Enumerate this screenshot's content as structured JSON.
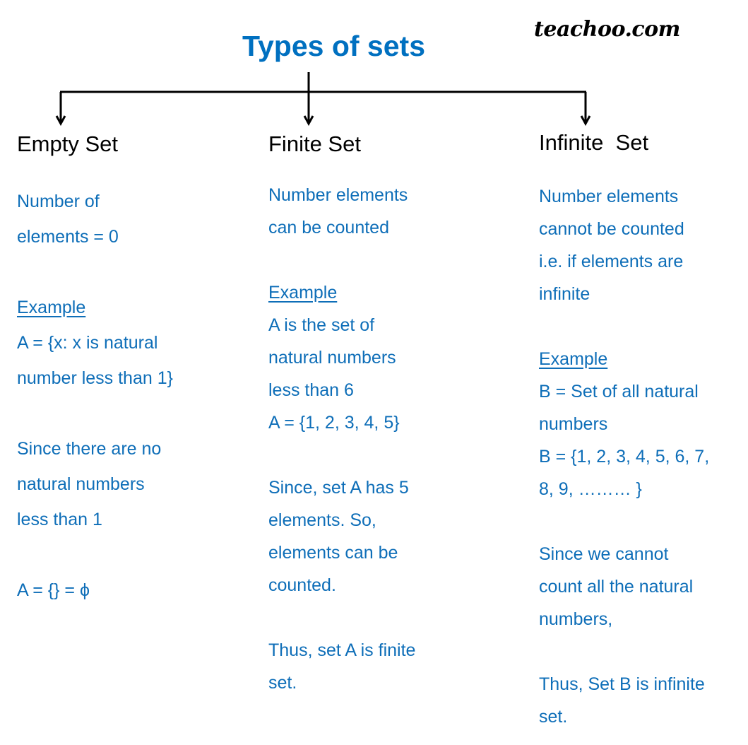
{
  "title": "Types of sets",
  "brand": "teachoo.com",
  "colors": {
    "title": "#0070C0",
    "body_text": "#0E6EB8",
    "heading": "#000000",
    "connector": "#000000"
  },
  "columns": [
    {
      "heading": "Empty Set",
      "lines": [
        {
          "text": "Number of"
        },
        {
          "text": "elements = 0"
        },
        {
          "text": ""
        },
        {
          "text": "Example",
          "underline": true
        },
        {
          "text": "A = {x: x is natural"
        },
        {
          "text": "number less than 1}"
        },
        {
          "text": ""
        },
        {
          "text": "Since there are no"
        },
        {
          "text": "natural numbers"
        },
        {
          "text": "less than 1"
        },
        {
          "text": ""
        },
        {
          "text": "A = {} = ϕ"
        }
      ]
    },
    {
      "heading": "Finite Set",
      "lines": [
        {
          "text": "Number elements"
        },
        {
          "text": "can be counted"
        },
        {
          "text": ""
        },
        {
          "text": "Example",
          "underline": true
        },
        {
          "text": "A is the set of"
        },
        {
          "text": "natural numbers"
        },
        {
          "text": "less than 6"
        },
        {
          "text": "A = {1, 2, 3, 4, 5}"
        },
        {
          "text": ""
        },
        {
          "text": "Since, set A has 5"
        },
        {
          "text": "elements. So,"
        },
        {
          "text": "elements can be"
        },
        {
          "text": "counted."
        },
        {
          "text": ""
        },
        {
          "text": "Thus, set A is finite"
        },
        {
          "text": "set."
        }
      ]
    },
    {
      "heading": "Infinite  Set",
      "lines": [
        {
          "text": "Number elements"
        },
        {
          "text": "cannot be counted"
        },
        {
          "text": "i.e. if elements are"
        },
        {
          "text": "infinite"
        },
        {
          "text": ""
        },
        {
          "text": "Example",
          "underline": true
        },
        {
          "text": "B = Set of all natural"
        },
        {
          "text": "numbers"
        },
        {
          "text": "B = {1, 2, 3, 4, 5, 6, 7,"
        },
        {
          "text": "8, 9, ……… }"
        },
        {
          "text": ""
        },
        {
          "text": "Since we cannot"
        },
        {
          "text": "count all the natural"
        },
        {
          "text": "numbers,"
        },
        {
          "text": ""
        },
        {
          "text": "Thus, Set B is infinite"
        },
        {
          "text": "set."
        }
      ]
    }
  ]
}
